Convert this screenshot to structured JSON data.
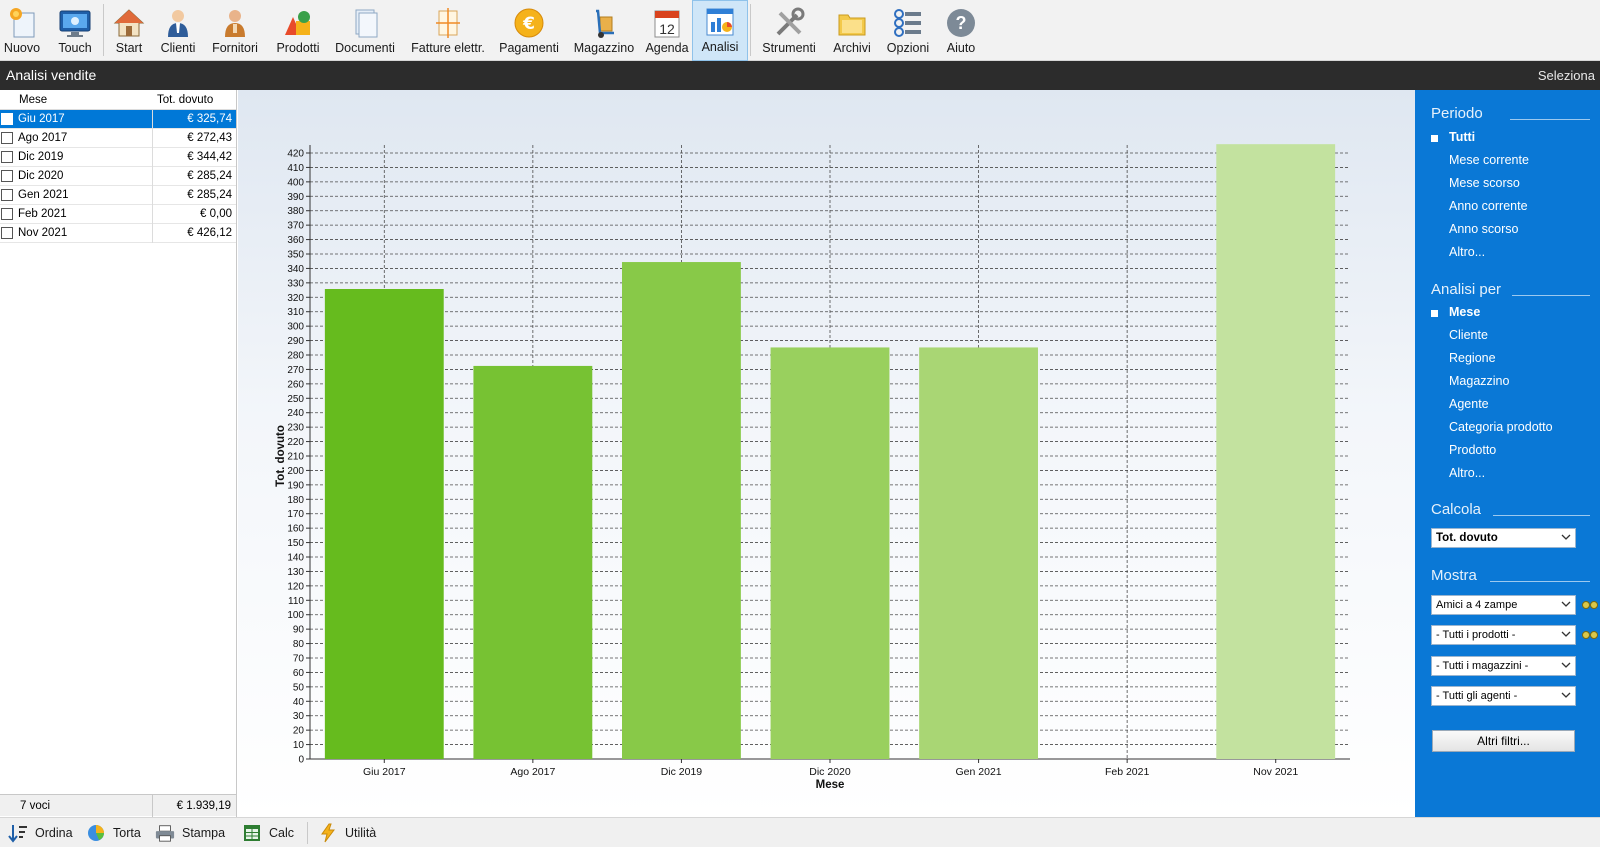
{
  "toolbar": {
    "items": [
      {
        "label": "Nuovo",
        "icon": "new-document-icon"
      },
      {
        "label": "Touch",
        "icon": "touch-monitor-icon"
      },
      {
        "label": "Start",
        "icon": "home-icon"
      },
      {
        "label": "Clienti",
        "icon": "customer-icon"
      },
      {
        "label": "Fornitori",
        "icon": "supplier-icon"
      },
      {
        "label": "Prodotti",
        "icon": "products-icon"
      },
      {
        "label": "Documenti",
        "icon": "documents-icon"
      },
      {
        "label": "Fatture elettr.",
        "icon": "e-invoice-icon"
      },
      {
        "label": "Pagamenti",
        "icon": "euro-coin-icon"
      },
      {
        "label": "Magazzino",
        "icon": "hand-truck-icon"
      },
      {
        "label": "Agenda",
        "icon": "calendar-icon",
        "day": "12"
      },
      {
        "label": "Analisi",
        "icon": "analysis-chart-icon",
        "active": true
      },
      {
        "label": "Strumenti",
        "icon": "tools-icon"
      },
      {
        "label": "Archivi",
        "icon": "folder-icon"
      },
      {
        "label": "Opzioni",
        "icon": "options-icon"
      },
      {
        "label": "Aiuto",
        "icon": "help-icon"
      }
    ]
  },
  "titlebar": {
    "title": "Analisi vendite",
    "action": "Seleziona"
  },
  "table": {
    "headers": [
      "Mese",
      "Tot. dovuto"
    ],
    "rows": [
      {
        "mese": "Giu 2017",
        "tot": "€ 325,74",
        "selected": true
      },
      {
        "mese": "Ago 2017",
        "tot": "€ 272,43"
      },
      {
        "mese": "Dic 2019",
        "tot": "€ 344,42"
      },
      {
        "mese": "Dic 2020",
        "tot": "€ 285,24"
      },
      {
        "mese": "Gen 2021",
        "tot": "€ 285,24"
      },
      {
        "mese": "Feb 2021",
        "tot": "€ 0,00"
      },
      {
        "mese": "Nov 2021",
        "tot": "€ 426,12"
      }
    ],
    "footer": {
      "count": "7 voci",
      "total": "€ 1.939,19"
    }
  },
  "chart_data": {
    "type": "bar",
    "categories": [
      "Giu 2017",
      "Ago 2017",
      "Dic 2019",
      "Dic 2020",
      "Gen 2021",
      "Feb 2021",
      "Nov 2021"
    ],
    "values": [
      325.74,
      272.43,
      344.42,
      285.24,
      285.24,
      0,
      426.12
    ],
    "bar_colors": [
      "#66bb1e",
      "#77c233",
      "#88c948",
      "#99d05e",
      "#a9d674",
      "#b9dd8a",
      "#c3e29f"
    ],
    "xlabel": "Mese",
    "ylabel": "Tot. dovuto",
    "ylim": [
      0,
      420
    ],
    "ytick_step": 10,
    "grid": true
  },
  "rightpanel": {
    "periodo": {
      "title": "Periodo",
      "items": [
        {
          "label": "Tutti",
          "on": true
        },
        {
          "label": "Mese corrente"
        },
        {
          "label": "Mese scorso"
        },
        {
          "label": "Anno corrente"
        },
        {
          "label": "Anno scorso"
        },
        {
          "label": "Altro..."
        }
      ]
    },
    "analisi": {
      "title": "Analisi per",
      "items": [
        {
          "label": "Mese",
          "on": true
        },
        {
          "label": "Cliente"
        },
        {
          "label": "Regione"
        },
        {
          "label": "Magazzino"
        },
        {
          "label": "Agente"
        },
        {
          "label": "Categoria prodotto"
        },
        {
          "label": "Prodotto"
        },
        {
          "label": "Altro..."
        }
      ]
    },
    "calcola": {
      "title": "Calcola",
      "value": "Tot. dovuto"
    },
    "mostra": {
      "title": "Mostra",
      "selects": [
        "Amici a 4 zampe",
        " - Tutti i prodotti -",
        " - Tutti i magazzini -",
        " - Tutti gli agenti -"
      ]
    },
    "altri_filtri": "Altri filtri..."
  },
  "bottombar": {
    "items": [
      {
        "label": "Ordina",
        "icon": "sort-icon"
      },
      {
        "label": "Torta",
        "icon": "pie-chart-icon"
      },
      {
        "label": "Stampa",
        "icon": "printer-icon"
      },
      {
        "label": "Calc",
        "icon": "spreadsheet-icon"
      },
      {
        "label": "Utilità",
        "icon": "lightning-icon"
      }
    ]
  }
}
